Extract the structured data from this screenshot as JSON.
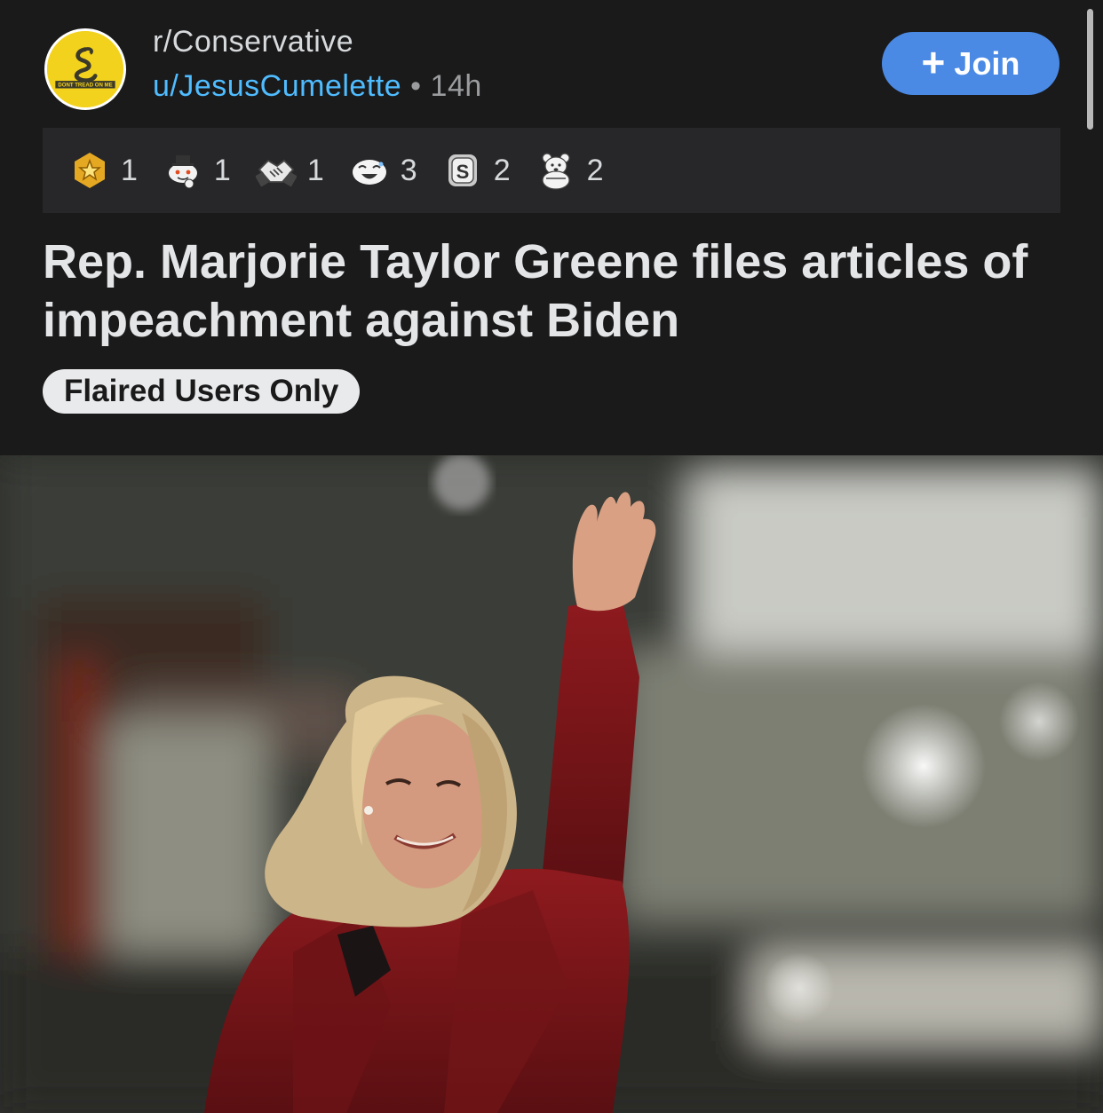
{
  "post": {
    "subreddit": "r/Conservative",
    "author": "u/JesusCumelette",
    "separator": "•",
    "age": "14h",
    "subreddit_icon": "gadsden-flag-icon",
    "subreddit_icon_text": "DONT TREAD ON ME",
    "join_label": "Join",
    "join_icon": "plus-icon",
    "title": "Rep. Marjorie Taylor Greene files articles of impeachment against Biden",
    "flair": "Flaired Users Only",
    "image": "photo of woman in red coat waving"
  },
  "awards": [
    {
      "icon": "gold-star-award-icon",
      "count": "1"
    },
    {
      "icon": "snoo-pilgrim-award-icon",
      "count": "1"
    },
    {
      "icon": "handshake-award-icon",
      "count": "1"
    },
    {
      "icon": "laughing-face-award-icon",
      "count": "3"
    },
    {
      "icon": "silver-award-icon",
      "count": "2"
    },
    {
      "icon": "bear-award-icon",
      "count": "2"
    }
  ],
  "colors": {
    "background": "#1a1a1b",
    "awards_bar": "#272729",
    "join_button": "#4a8ae5",
    "username": "#4fbcff",
    "flair_background": "#e9eaeb",
    "avatar_background": "#f3d21d"
  }
}
